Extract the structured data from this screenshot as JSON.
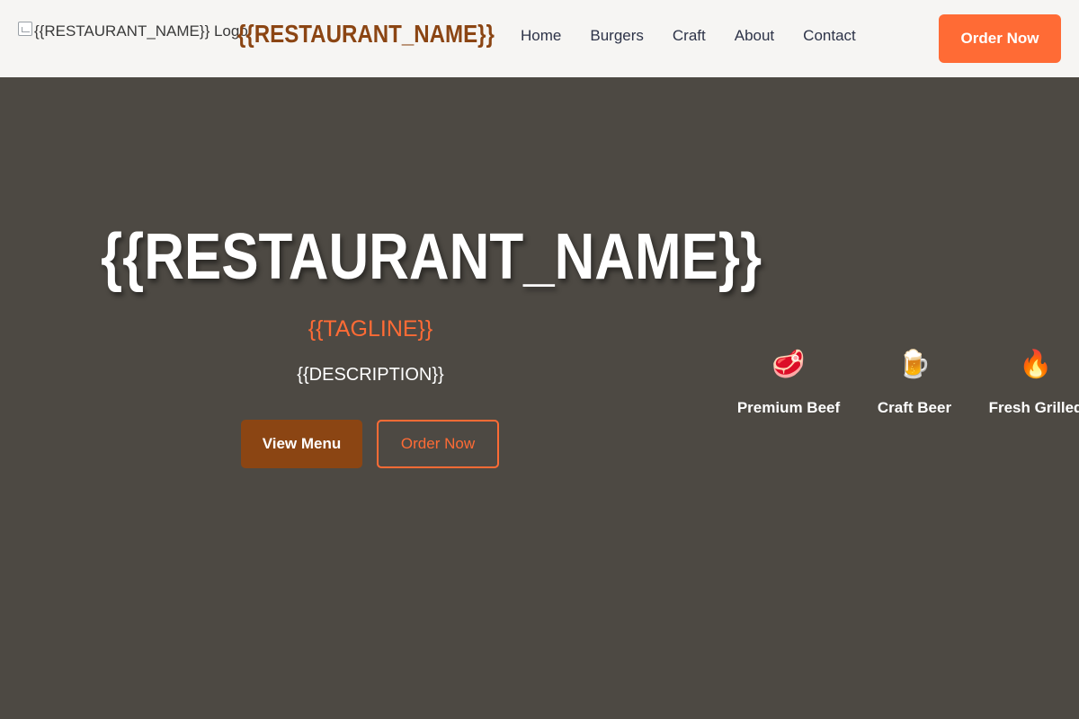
{
  "header": {
    "logo_alt": "{{RESTAURANT_NAME}} Logo",
    "brand": "{{RESTAURANT_NAME}}",
    "nav": [
      "Home",
      "Burgers",
      "Craft",
      "About",
      "Contact"
    ],
    "order_button": "Order Now"
  },
  "hero": {
    "title": "{{RESTAURANT_NAME}}",
    "tagline": "{{TAGLINE}}",
    "description": "{{DESCRIPTION}}",
    "primary_button": "View Menu",
    "secondary_button": "Order Now"
  },
  "features": [
    {
      "icon": "steak-icon",
      "glyph": "🥩",
      "label": "Premium Beef"
    },
    {
      "icon": "beer-mug-icon",
      "glyph": "🍺",
      "label": "Craft Beer"
    },
    {
      "icon": "fire-icon",
      "glyph": "🔥",
      "label": "Fresh Grilled"
    }
  ],
  "colors": {
    "accent": "#ff6b35",
    "brand_brown": "#8b4513",
    "hero_bg": "#4d4943",
    "nav_bg": "#f6f5f3",
    "nav_text": "#2d3348"
  }
}
